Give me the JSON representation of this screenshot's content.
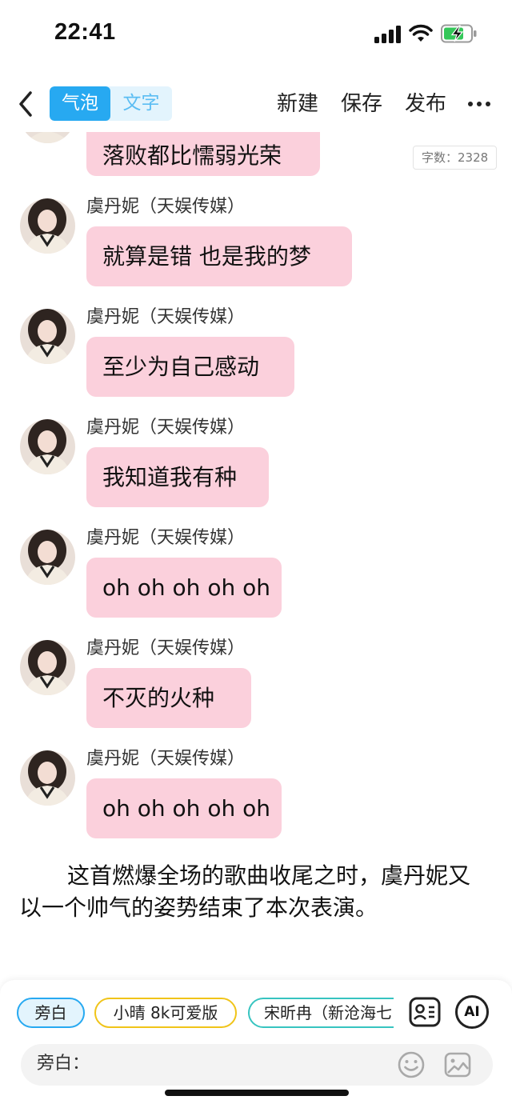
{
  "status": {
    "time": "22:41"
  },
  "header": {
    "seg_bubble": "气泡",
    "seg_text": "文字",
    "new": "新建",
    "save": "保存",
    "publish": "发布"
  },
  "chat": {
    "word_count": "字数：2328",
    "top_partial_bubble": "落败都比懦弱光荣",
    "messages": [
      {
        "name": "虞丹妮（天娱传媒）",
        "text": "就算是错 也是我的梦"
      },
      {
        "name": "虞丹妮（天娱传媒）",
        "text": "至少为自己感动"
      },
      {
        "name": "虞丹妮（天娱传媒）",
        "text": "我知道我有种"
      },
      {
        "name": "虞丹妮（天娱传媒）",
        "text": "oh oh oh oh oh"
      },
      {
        "name": "虞丹妮（天娱传媒）",
        "text": "不灭的火种"
      },
      {
        "name": "虞丹妮（天娱传媒）",
        "text": "oh oh oh oh oh"
      }
    ],
    "narration": "这首燃爆全场的歌曲收尾之时，虞丹妮又以一个帅气的姿势结束了本次表演。"
  },
  "bottom": {
    "roles": [
      "旁白",
      "小晴 8k可爱版",
      "宋昕冉（新沧海七"
    ],
    "ai_label": "AI",
    "input_label": "旁白："
  }
}
